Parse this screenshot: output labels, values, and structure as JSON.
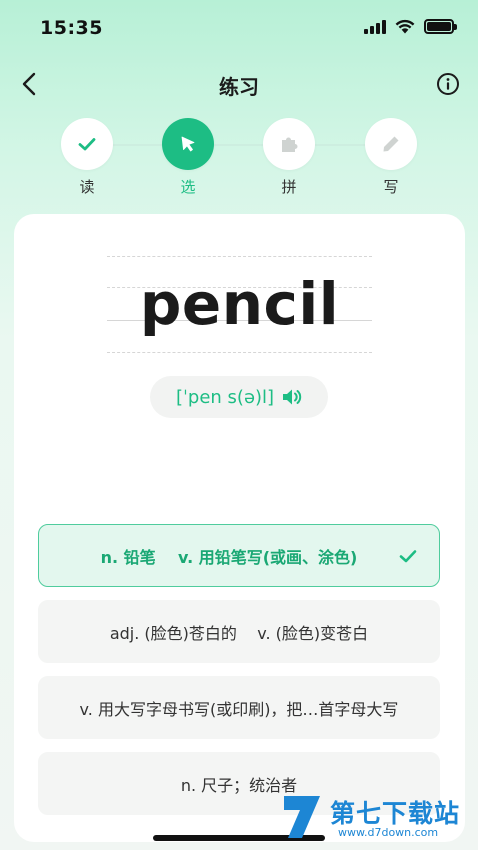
{
  "status_bar": {
    "time": "15:35"
  },
  "header": {
    "title": "练习"
  },
  "steps": [
    {
      "label": "读",
      "icon": "check-icon",
      "state": "done"
    },
    {
      "label": "选",
      "icon": "cursor-icon",
      "state": "active"
    },
    {
      "label": "拼",
      "icon": "puzzle-icon",
      "state": "pending"
    },
    {
      "label": "写",
      "icon": "pencil-icon",
      "state": "pending"
    }
  ],
  "word": {
    "text": "pencil",
    "phonetic": "[ˈpen s(ə)l]",
    "speaker_icon": "speaker-icon"
  },
  "options": [
    {
      "text": "n. 铅笔    v. 用铅笔写(或画、涂色)",
      "state": "correct"
    },
    {
      "text": "adj. (脸色)苍白的    v. (脸色)变苍白",
      "state": "normal"
    },
    {
      "text": "v. 用大写字母书写(或印刷)，把…首字母大写",
      "state": "normal"
    },
    {
      "text": "n. 尺子；统治者",
      "state": "normal"
    }
  ],
  "colors": {
    "accent": "#1dbd84",
    "watermark": "#1d86d4"
  },
  "watermark": {
    "title": "第七下载站",
    "url": "www.d7down.com"
  }
}
